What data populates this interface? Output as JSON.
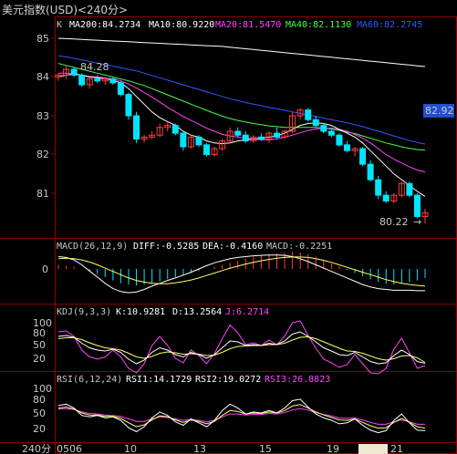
{
  "window": {
    "title": "美元指数(USD)<240分>"
  },
  "colors": {
    "bg": "#000000",
    "grid": "#8b0000",
    "up": "#ff3b3b",
    "down": "#00e5ff",
    "text": "#c8c8c8",
    "highlight": "#1f4fd0"
  },
  "main_panel": {
    "label": "K",
    "indicators": [
      {
        "name": "MA200",
        "value": "84.2734",
        "color": "#ffffff"
      },
      {
        "name": "MA10",
        "value": "80.9220",
        "color": "#ffffff"
      },
      {
        "name": "MA20",
        "value": "81.5470",
        "color": "#ff44ff"
      },
      {
        "name": "MA40",
        "value": "82.1130",
        "color": "#44ff44"
      },
      {
        "name": "MA60",
        "value": "82.2745",
        "color": "#3355ff"
      }
    ],
    "y_ticks": [
      "85",
      "84",
      "83",
      "82",
      "81"
    ],
    "price_tag": "82.92",
    "high_label": "84.28",
    "low_label": "80.22"
  },
  "macd_panel": {
    "label": "MACD(26,12,9)",
    "diff": "DIFF:-0.5285",
    "dea": "DEA:-0.4160",
    "macd": "MACD:-0.2251",
    "y_tick": "0"
  },
  "kdj_panel": {
    "label": "KDJ(9,3,3)",
    "k": "K:10.9281",
    "d": "D:13.2564",
    "j": "J:6.2714",
    "y_ticks": [
      "100",
      "80",
      "50",
      "20"
    ]
  },
  "rsi_panel": {
    "label": "RSI(6,12,24)",
    "rsi1": "RSI1:14.1729",
    "rsi2": "RSI2:19.0272",
    "rsi3": "RSI3:26.8823",
    "y_ticks": [
      "100",
      "80",
      "50",
      "20"
    ]
  },
  "x_axis": {
    "period": "240分",
    "labels": [
      "0506",
      "10",
      "13",
      "15",
      "19",
      "21"
    ]
  },
  "chart_data": {
    "type": "candlestick",
    "y_range": [
      80.0,
      85.2
    ],
    "candles": [
      [
        84.0,
        84.1,
        83.9,
        84.05
      ],
      [
        84.05,
        84.28,
        83.95,
        84.2
      ],
      [
        84.2,
        84.25,
        84.0,
        84.05
      ],
      [
        84.05,
        84.1,
        83.75,
        83.8
      ],
      [
        83.8,
        84.0,
        83.7,
        83.95
      ],
      [
        83.95,
        84.05,
        83.85,
        83.9
      ],
      [
        83.9,
        84.0,
        83.8,
        83.95
      ],
      [
        83.95,
        84.0,
        83.8,
        83.85
      ],
      [
        83.85,
        83.9,
        83.5,
        83.55
      ],
      [
        83.55,
        83.6,
        82.9,
        83.0
      ],
      [
        83.0,
        83.1,
        82.3,
        82.4
      ],
      [
        82.4,
        82.5,
        82.3,
        82.45
      ],
      [
        82.45,
        82.6,
        82.4,
        82.5
      ],
      [
        82.5,
        82.8,
        82.45,
        82.7
      ],
      [
        82.7,
        82.85,
        82.6,
        82.75
      ],
      [
        82.75,
        82.8,
        82.5,
        82.55
      ],
      [
        82.55,
        82.6,
        82.1,
        82.2
      ],
      [
        82.2,
        82.5,
        82.15,
        82.45
      ],
      [
        82.45,
        82.5,
        82.2,
        82.25
      ],
      [
        82.25,
        82.3,
        81.95,
        82.0
      ],
      [
        82.0,
        82.2,
        81.95,
        82.15
      ],
      [
        82.15,
        82.4,
        82.1,
        82.35
      ],
      [
        82.35,
        82.7,
        82.3,
        82.6
      ],
      [
        82.6,
        82.7,
        82.45,
        82.5
      ],
      [
        82.5,
        82.6,
        82.3,
        82.35
      ],
      [
        82.35,
        82.5,
        82.3,
        82.45
      ],
      [
        82.45,
        82.55,
        82.35,
        82.4
      ],
      [
        82.4,
        82.6,
        82.3,
        82.55
      ],
      [
        82.55,
        82.7,
        82.4,
        82.45
      ],
      [
        82.45,
        82.65,
        82.4,
        82.6
      ],
      [
        82.6,
        83.1,
        82.55,
        83.0
      ],
      [
        83.0,
        83.2,
        82.9,
        83.15
      ],
      [
        83.15,
        83.2,
        82.85,
        82.9
      ],
      [
        82.9,
        83.0,
        82.7,
        82.75
      ],
      [
        82.75,
        82.8,
        82.55,
        82.6
      ],
      [
        82.6,
        82.7,
        82.45,
        82.5
      ],
      [
        82.5,
        82.55,
        82.2,
        82.25
      ],
      [
        82.25,
        82.35,
        82.05,
        82.1
      ],
      [
        82.1,
        82.2,
        81.95,
        82.15
      ],
      [
        82.15,
        82.2,
        81.7,
        81.75
      ],
      [
        81.75,
        81.85,
        81.3,
        81.35
      ],
      [
        81.35,
        81.45,
        80.85,
        80.95
      ],
      [
        80.95,
        81.05,
        80.75,
        80.8
      ],
      [
        80.8,
        81.0,
        80.75,
        80.95
      ],
      [
        80.95,
        81.3,
        80.9,
        81.25
      ],
      [
        81.25,
        81.3,
        80.9,
        80.95
      ],
      [
        80.95,
        81.0,
        80.35,
        80.4
      ],
      [
        80.4,
        80.6,
        80.22,
        80.5
      ]
    ],
    "ma10": [
      84.0,
      84.05,
      84.08,
      84.05,
      84.0,
      83.98,
      83.95,
      83.92,
      83.85,
      83.7,
      83.5,
      83.3,
      83.1,
      82.95,
      82.85,
      82.75,
      82.6,
      82.5,
      82.45,
      82.35,
      82.3,
      82.28,
      82.3,
      82.35,
      82.38,
      82.4,
      82.42,
      82.45,
      82.48,
      82.55,
      82.65,
      82.75,
      82.8,
      82.82,
      82.8,
      82.75,
      82.65,
      82.55,
      82.45,
      82.3,
      82.1,
      81.9,
      81.7,
      81.5,
      81.35,
      81.2,
      81.05,
      80.92
    ],
    "ma20": [
      84.1,
      84.1,
      84.08,
      84.05,
      84.02,
      84.0,
      83.98,
      83.95,
      83.9,
      83.82,
      83.72,
      83.6,
      83.48,
      83.35,
      83.22,
      83.1,
      82.98,
      82.88,
      82.78,
      82.68,
      82.6,
      82.52,
      82.48,
      82.45,
      82.42,
      82.4,
      82.38,
      82.38,
      82.4,
      82.45,
      82.5,
      82.56,
      82.62,
      82.66,
      82.68,
      82.68,
      82.65,
      82.6,
      82.52,
      82.42,
      82.3,
      82.15,
      82.0,
      81.88,
      81.78,
      81.68,
      81.6,
      81.55
    ],
    "ma40": [
      84.35,
      84.3,
      84.25,
      84.2,
      84.15,
      84.1,
      84.05,
      84.0,
      83.95,
      83.9,
      83.84,
      83.78,
      83.7,
      83.62,
      83.54,
      83.46,
      83.38,
      83.3,
      83.22,
      83.14,
      83.06,
      82.99,
      82.93,
      82.88,
      82.84,
      82.8,
      82.77,
      82.74,
      82.72,
      82.7,
      82.7,
      82.7,
      82.7,
      82.7,
      82.68,
      82.66,
      82.62,
      82.58,
      82.54,
      82.48,
      82.42,
      82.36,
      82.3,
      82.25,
      82.2,
      82.16,
      82.13,
      82.11
    ],
    "ma60": [
      84.55,
      84.52,
      84.48,
      84.44,
      84.4,
      84.36,
      84.32,
      84.28,
      84.24,
      84.2,
      84.16,
      84.1,
      84.04,
      83.98,
      83.92,
      83.86,
      83.8,
      83.74,
      83.68,
      83.62,
      83.56,
      83.5,
      83.44,
      83.39,
      83.34,
      83.3,
      83.26,
      83.22,
      83.18,
      83.14,
      83.1,
      83.06,
      83.02,
      82.98,
      82.94,
      82.9,
      82.86,
      82.82,
      82.77,
      82.72,
      82.66,
      82.6,
      82.54,
      82.48,
      82.42,
      82.36,
      82.31,
      82.27
    ],
    "ma200": [
      85.0,
      84.99,
      84.98,
      84.97,
      84.96,
      84.95,
      84.94,
      84.93,
      84.92,
      84.91,
      84.9,
      84.89,
      84.88,
      84.87,
      84.86,
      84.85,
      84.84,
      84.83,
      84.82,
      84.81,
      84.8,
      84.79,
      84.77,
      84.75,
      84.73,
      84.71,
      84.69,
      84.67,
      84.65,
      84.63,
      84.61,
      84.59,
      84.57,
      84.55,
      84.53,
      84.51,
      84.49,
      84.47,
      84.45,
      84.43,
      84.41,
      84.39,
      84.37,
      84.35,
      84.33,
      84.31,
      84.29,
      84.27
    ],
    "macd_bars": [
      0.1,
      0.08,
      0.05,
      0.0,
      -0.05,
      -0.12,
      -0.2,
      -0.28,
      -0.35,
      -0.38,
      -0.4,
      -0.38,
      -0.34,
      -0.3,
      -0.25,
      -0.2,
      -0.15,
      -0.1,
      -0.05,
      0.0,
      0.05,
      0.1,
      0.15,
      0.2,
      0.25,
      0.3,
      0.33,
      0.36,
      0.38,
      0.4,
      0.42,
      0.4,
      0.36,
      0.3,
      0.22,
      0.14,
      0.06,
      -0.02,
      -0.1,
      -0.18,
      -0.25,
      -0.32,
      -0.36,
      -0.38,
      -0.36,
      -0.32,
      -0.28,
      -0.22
    ],
    "diff": [
      0.3,
      0.28,
      0.22,
      0.1,
      -0.05,
      -0.2,
      -0.35,
      -0.48,
      -0.55,
      -0.58,
      -0.56,
      -0.5,
      -0.42,
      -0.35,
      -0.28,
      -0.22,
      -0.15,
      -0.08,
      0.0,
      0.08,
      0.15,
      0.2,
      0.25,
      0.28,
      0.3,
      0.32,
      0.33,
      0.34,
      0.34,
      0.33,
      0.3,
      0.25,
      0.18,
      0.1,
      0.02,
      -0.06,
      -0.14,
      -0.22,
      -0.3,
      -0.38,
      -0.44,
      -0.48,
      -0.5,
      -0.52,
      -0.52,
      -0.52,
      -0.53,
      -0.53
    ],
    "dea": [
      0.25,
      0.26,
      0.25,
      0.22,
      0.17,
      0.1,
      0.02,
      -0.06,
      -0.14,
      -0.22,
      -0.28,
      -0.32,
      -0.35,
      -0.36,
      -0.36,
      -0.34,
      -0.31,
      -0.27,
      -0.22,
      -0.16,
      -0.1,
      -0.04,
      0.02,
      0.07,
      0.12,
      0.16,
      0.2,
      0.23,
      0.26,
      0.28,
      0.29,
      0.29,
      0.28,
      0.25,
      0.21,
      0.16,
      0.1,
      0.04,
      -0.02,
      -0.08,
      -0.14,
      -0.2,
      -0.26,
      -0.31,
      -0.35,
      -0.38,
      -0.4,
      -0.42
    ],
    "kdj_k": [
      70,
      72,
      68,
      55,
      45,
      40,
      38,
      42,
      35,
      20,
      10,
      18,
      35,
      45,
      40,
      30,
      25,
      35,
      30,
      22,
      30,
      45,
      60,
      58,
      50,
      52,
      50,
      55,
      52,
      60,
      75,
      80,
      70,
      58,
      45,
      38,
      30,
      28,
      35,
      25,
      15,
      10,
      12,
      28,
      40,
      30,
      15,
      11
    ],
    "kdj_d": [
      65,
      67,
      67,
      63,
      56,
      50,
      45,
      43,
      40,
      33,
      25,
      22,
      26,
      33,
      36,
      34,
      31,
      32,
      31,
      28,
      29,
      35,
      43,
      48,
      49,
      50,
      50,
      52,
      52,
      55,
      62,
      68,
      69,
      65,
      58,
      51,
      44,
      38,
      37,
      33,
      27,
      21,
      18,
      21,
      27,
      28,
      23,
      13
    ],
    "kdj_j": [
      80,
      82,
      70,
      40,
      25,
      20,
      25,
      40,
      25,
      0,
      -10,
      10,
      50,
      70,
      50,
      22,
      12,
      40,
      28,
      10,
      32,
      65,
      95,
      78,
      52,
      56,
      50,
      62,
      52,
      70,
      100,
      104,
      72,
      44,
      20,
      12,
      2,
      8,
      30,
      10,
      -10,
      -12,
      0,
      42,
      66,
      34,
      0,
      6
    ],
    "rsi1": [
      65,
      68,
      60,
      45,
      42,
      45,
      40,
      42,
      35,
      20,
      12,
      22,
      40,
      52,
      45,
      32,
      25,
      38,
      30,
      22,
      35,
      55,
      68,
      60,
      48,
      52,
      50,
      55,
      50,
      60,
      75,
      78,
      62,
      48,
      40,
      35,
      28,
      30,
      38,
      25,
      15,
      10,
      14,
      35,
      48,
      30,
      15,
      14
    ],
    "rsi2": [
      60,
      62,
      58,
      50,
      46,
      46,
      43,
      43,
      39,
      30,
      22,
      26,
      36,
      44,
      42,
      36,
      31,
      36,
      33,
      28,
      33,
      45,
      55,
      53,
      48,
      50,
      49,
      52,
      50,
      55,
      64,
      67,
      60,
      52,
      46,
      41,
      36,
      35,
      38,
      31,
      24,
      19,
      20,
      31,
      39,
      31,
      22,
      19
    ],
    "rsi3": [
      58,
      59,
      57,
      52,
      49,
      48,
      46,
      45,
      43,
      38,
      33,
      33,
      38,
      42,
      41,
      38,
      35,
      37,
      35,
      32,
      35,
      42,
      48,
      48,
      46,
      47,
      47,
      49,
      48,
      51,
      56,
      59,
      56,
      51,
      47,
      44,
      40,
      39,
      40,
      36,
      31,
      27,
      27,
      32,
      36,
      32,
      27,
      27
    ]
  }
}
